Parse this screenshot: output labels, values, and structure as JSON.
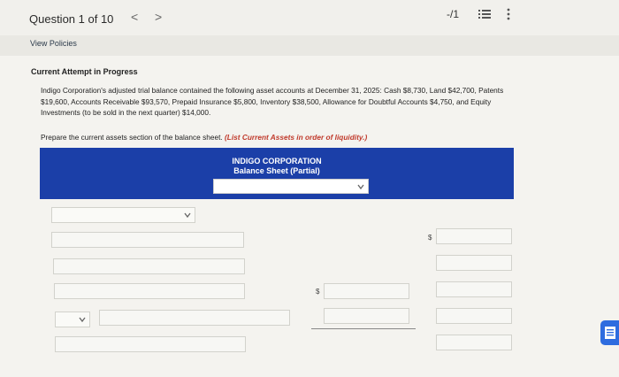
{
  "header": {
    "question_label": "Question 1 of 10",
    "prev_glyph": "<",
    "next_glyph": ">",
    "score": "-/1"
  },
  "links": {
    "view_policies": "View Policies"
  },
  "attempt": {
    "heading": "Current Attempt in Progress"
  },
  "problem": {
    "text": "Indigo Corporation's adjusted trial balance contained the following asset accounts at December 31, 2025: Cash $8,730, Land $42,700, Patents $19,600, Accounts Receivable $93,570, Prepaid Insurance $5,800, Inventory $38,500, Allowance for Doubtful Accounts $4,750, and Equity Investments (to be sold in the next quarter) $14,000.",
    "instruction": "Prepare the current assets section of the balance sheet.",
    "hint": "(List Current Assets in order of liquidity.)"
  },
  "statement": {
    "company": "INDIGO CORPORATION",
    "title": "Balance Sheet (Partial)",
    "period_selected": ""
  },
  "form": {
    "dollar_sign": "$",
    "fields": [
      "",
      "",
      "",
      "",
      "",
      "",
      "",
      "",
      "",
      "",
      "",
      "",
      "",
      "",
      ""
    ]
  },
  "colors": {
    "banner": "#1b3fa8",
    "hint": "#c0392b",
    "help": "#2e6cdf"
  },
  "icons": [
    "list-icon",
    "more-icon",
    "chevron-down-icon",
    "help-icon"
  ]
}
